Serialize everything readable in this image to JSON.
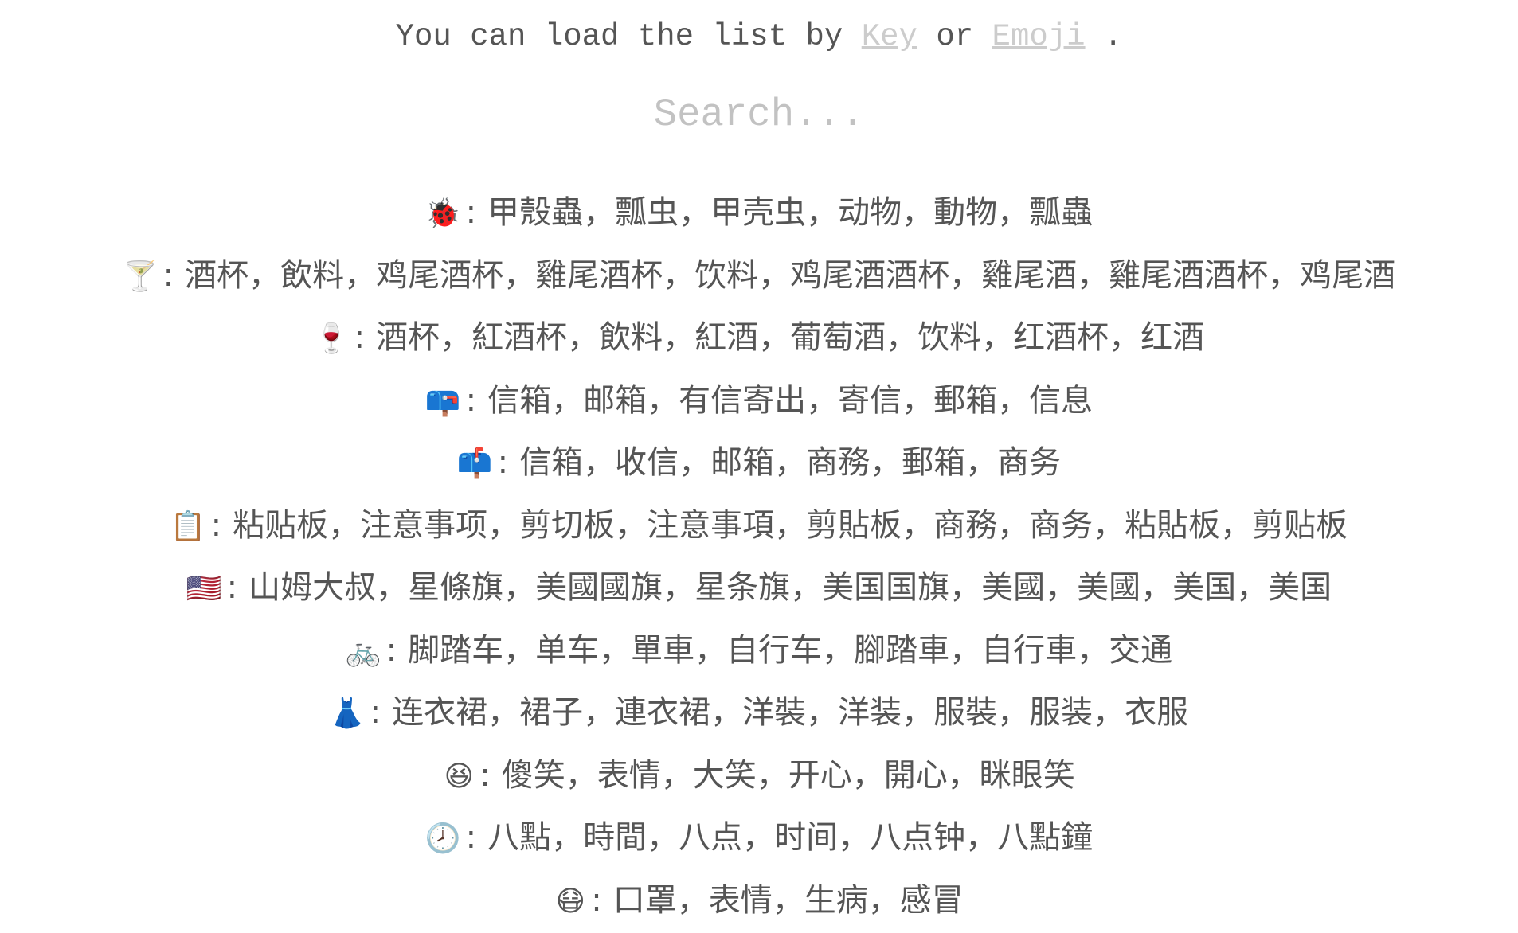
{
  "intro": {
    "prefix": "You can load the list by",
    "link_key": "Key",
    "middle": "or",
    "link_emoji": "Emoji",
    "suffix": "."
  },
  "search": {
    "placeholder": "Search...",
    "value": ""
  },
  "separator": ":",
  "entries": [
    {
      "icon": "ladybug-icon",
      "emoji": "🐞",
      "names": "甲殼蟲，瓢虫，甲壳虫，动物，動物，瓢蟲"
    },
    {
      "icon": "cocktail-glass-icon",
      "emoji": "🍸",
      "names": "酒杯，飲料，鸡尾酒杯，雞尾酒杯，饮料，鸡尾酒酒杯，雞尾酒，雞尾酒酒杯，鸡尾酒"
    },
    {
      "icon": "wine-glass-icon",
      "emoji": "🍷",
      "names": "酒杯，紅酒杯，飲料，紅酒，葡萄酒，饮料，红酒杯，红酒"
    },
    {
      "icon": "mailbox-flag-down-icon",
      "emoji": "📪",
      "names": "信箱，邮箱，有信寄出，寄信，郵箱，信息"
    },
    {
      "icon": "mailbox-flag-up-icon",
      "emoji": "📫",
      "names": "信箱，收信，邮箱，商務，郵箱，商务"
    },
    {
      "icon": "clipboard-icon",
      "emoji": "📋",
      "names": "粘贴板，注意事项，剪切板，注意事項，剪貼板，商務，商务，粘貼板，剪贴板"
    },
    {
      "icon": "us-flag-icon",
      "emoji": "🇺🇸",
      "names": "山姆大叔，星條旗，美國國旗，星条旗，美国国旗，美國，美國，美国，美国"
    },
    {
      "icon": "bicycle-icon",
      "emoji": "🚲",
      "names": "脚踏车，单车，單車，自行车，腳踏車，自行車，交通"
    },
    {
      "icon": "dress-icon",
      "emoji": "👗",
      "names": "连衣裙，裙子，連衣裙，洋裝，洋装，服裝，服装，衣服"
    },
    {
      "icon": "grinning-squinting-face-icon",
      "emoji": "😆",
      "names": "傻笑，表情，大笑，开心，開心，眯眼笑"
    },
    {
      "icon": "eight-oclock-icon",
      "emoji": "🕗",
      "names": "八點，時間，八点，时间，八点钟，八點鐘"
    },
    {
      "icon": "face-with-medical-mask-icon",
      "emoji": "😷",
      "names": "口罩，表情，生病，感冒"
    }
  ]
}
